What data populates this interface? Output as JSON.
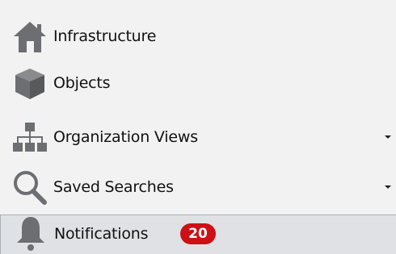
{
  "nav": {
    "items": [
      {
        "label": "Infrastructure",
        "icon": "home-icon",
        "has_dropdown": false
      },
      {
        "label": "Objects",
        "icon": "cube-icon",
        "has_dropdown": false
      },
      {
        "label": "Organization Views",
        "icon": "org-chart-icon",
        "has_dropdown": true
      },
      {
        "label": "Saved Searches",
        "icon": "search-icon",
        "has_dropdown": true
      },
      {
        "label": "Notifications",
        "icon": "bell-icon",
        "has_dropdown": false,
        "badge": "20",
        "selected": true
      }
    ]
  },
  "colors": {
    "icon": "#6d6e71",
    "badge_bg": "#cc1016",
    "selected_bg": "#dfe1e4"
  }
}
